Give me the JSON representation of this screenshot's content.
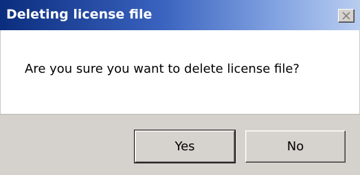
{
  "window": {
    "title": "Deleting license file",
    "close_icon": "close-icon"
  },
  "message": "Are you sure you want to delete license file?",
  "buttons": {
    "yes_label": "Yes",
    "no_label": "No"
  },
  "colors": {
    "titlebar_start": "#0b2d7e",
    "titlebar_end": "#b9cdf0",
    "button_face": "#d6d3ce",
    "button_bar": "#d5d2cd"
  }
}
